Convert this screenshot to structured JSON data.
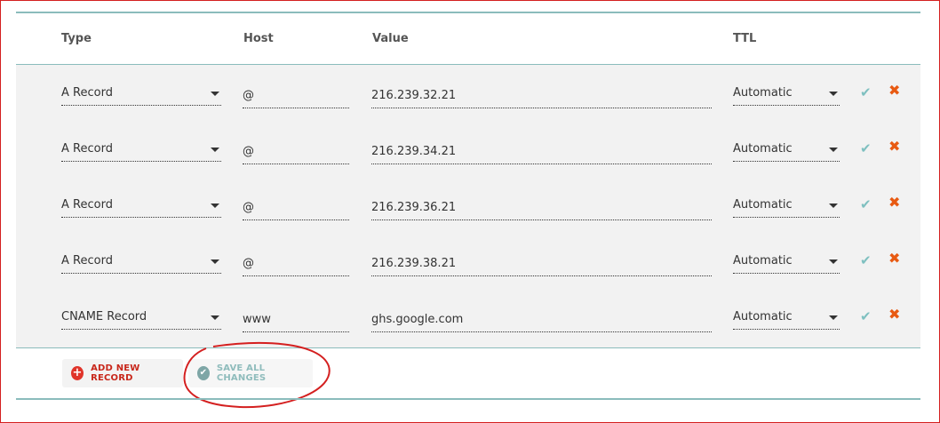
{
  "table": {
    "headers": {
      "type": "Type",
      "host": "Host",
      "value": "Value",
      "ttl": "TTL"
    },
    "rows": [
      {
        "type": "A Record",
        "host": "@",
        "value": "216.239.32.21",
        "ttl": "Automatic"
      },
      {
        "type": "A Record",
        "host": "@",
        "value": "216.239.34.21",
        "ttl": "Automatic"
      },
      {
        "type": "A Record",
        "host": "@",
        "value": "216.239.36.21",
        "ttl": "Automatic"
      },
      {
        "type": "A Record",
        "host": "@",
        "value": "216.239.38.21",
        "ttl": "Automatic"
      },
      {
        "type": "CNAME Record",
        "host": "www",
        "value": "ghs.google.com",
        "ttl": "Automatic"
      }
    ]
  },
  "actions": {
    "add_label": "ADD NEW RECORD",
    "save_label": "SAVE ALL CHANGES"
  },
  "icons": {
    "confirm": "check-icon",
    "delete": "x-icon",
    "add": "plus-circle-icon",
    "save": "check-circle-icon",
    "dropdown": "caret-down-icon"
  },
  "colors": {
    "accent_teal": "#8bbcbc",
    "delete_orange": "#e85a12",
    "add_red": "#e0342a",
    "annotation_red": "#d42020"
  }
}
